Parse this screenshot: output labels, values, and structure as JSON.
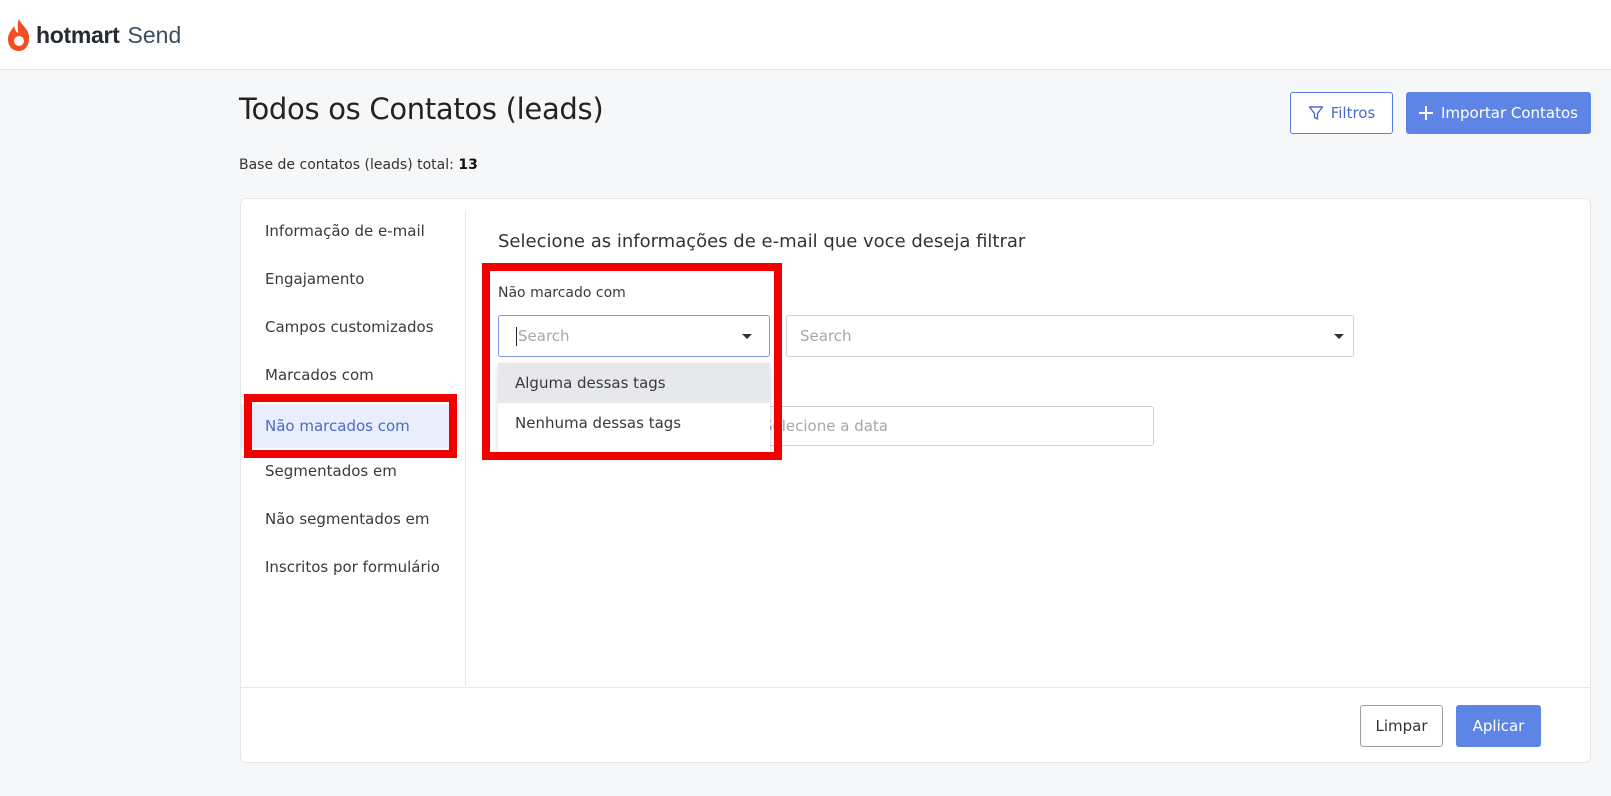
{
  "brand": {
    "name": "hotmart",
    "product": "Send",
    "color": "#f04e23"
  },
  "header": {
    "title": "Todos os Contatos (leads)",
    "total_label": "Base de contatos (leads) total:",
    "total_value": "13",
    "filter_button": "Filtros",
    "import_button": "Importar Contatos"
  },
  "sidebar": {
    "items": [
      {
        "label": "Informação de e-mail"
      },
      {
        "label": "Engajamento"
      },
      {
        "label": "Campos customizados"
      },
      {
        "label": "Marcados com"
      },
      {
        "label": "Não marcados com"
      },
      {
        "label": "Segmentados em"
      },
      {
        "label": "Não segmentados em"
      },
      {
        "label": "Inscritos por formulário"
      }
    ],
    "active_item": "Não marcados com"
  },
  "main": {
    "title": "Selecione as informações de e-mail que voce deseja filtrar",
    "field_label": "Não marcado com",
    "condition_select": {
      "placeholder": "Search",
      "icon": "chevron-down-icon"
    },
    "tags_select": {
      "placeholder": "Search",
      "icon": "chevron-down-icon"
    },
    "date_input": {
      "placeholder": "Selecione a data"
    },
    "dropdown_options": [
      {
        "label": "Alguma dessas tags"
      },
      {
        "label": "Nenhuma dessas tags"
      }
    ]
  },
  "footer": {
    "clear_button": "Limpar",
    "apply_button": "Aplicar"
  },
  "colors": {
    "accent": "#5e85e6",
    "highlight": "#f20000",
    "active_bg": "#e8eefc"
  }
}
